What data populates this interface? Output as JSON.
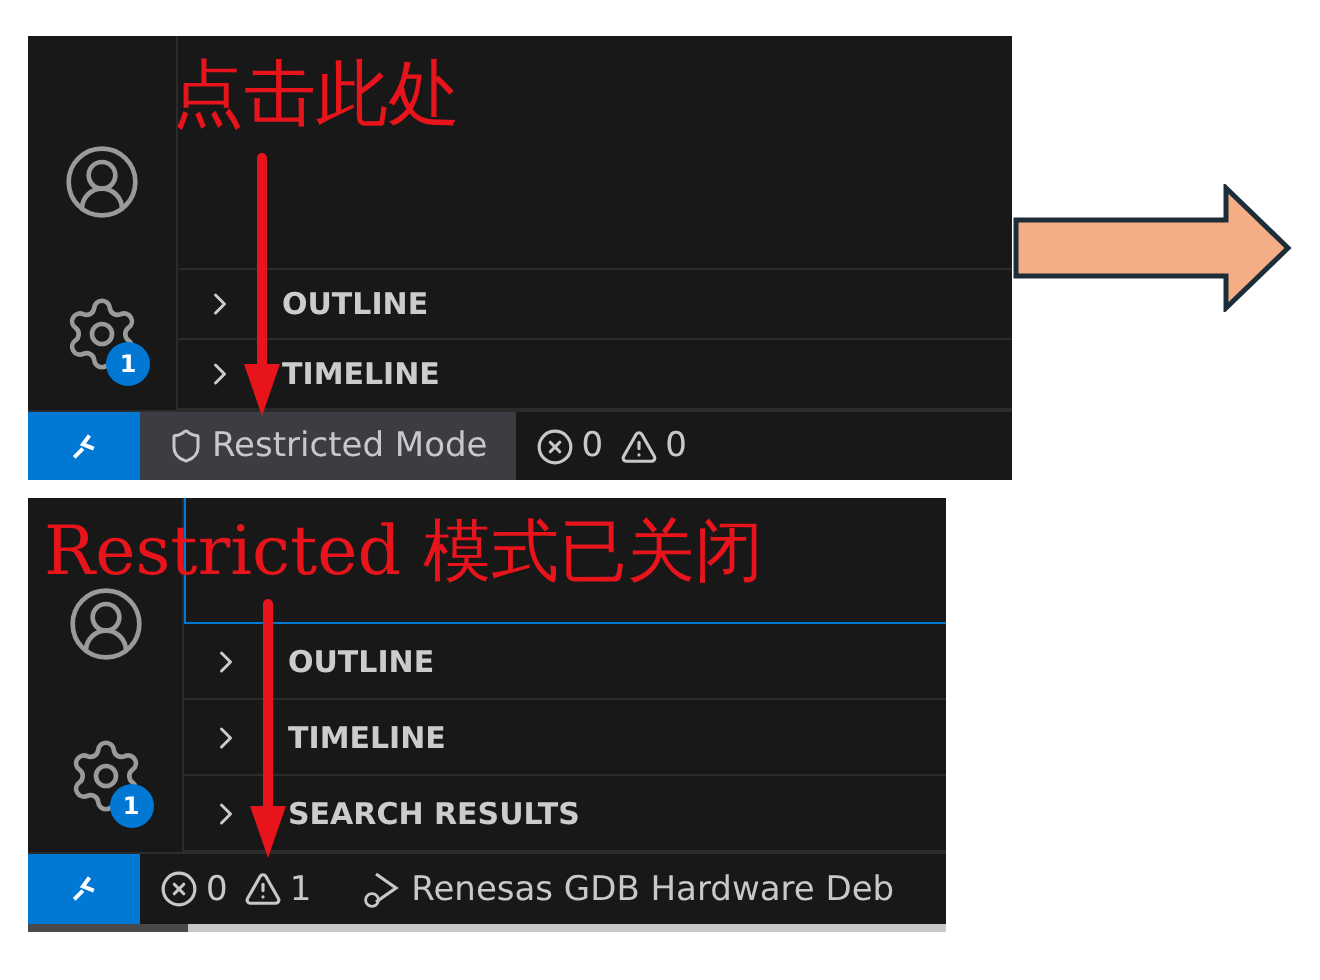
{
  "panels": [
    {
      "annotation": "点击此处",
      "focused_view": false,
      "scrollbar": false,
      "activity_badge": "1",
      "sections": [
        {
          "title": "OUTLINE",
          "expanded": false
        },
        {
          "title": "TIMELINE",
          "expanded": false
        }
      ],
      "status_items": [
        {
          "kind": "remote"
        },
        {
          "kind": "restricted",
          "label": "Restricted Mode"
        },
        {
          "kind": "problems",
          "errors": "0",
          "warnings": "0"
        }
      ]
    },
    {
      "annotation": "Restricted 模式已关闭",
      "focused_view": true,
      "scrollbar": true,
      "activity_badge": "1",
      "sections": [
        {
          "title": "OUTLINE",
          "expanded": false
        },
        {
          "title": "TIMELINE",
          "expanded": false
        },
        {
          "title": "SEARCH RESULTS",
          "expanded": false
        }
      ],
      "status_items": [
        {
          "kind": "remote"
        },
        {
          "kind": "problems",
          "errors": "0",
          "warnings": "1"
        },
        {
          "kind": "debug",
          "label": "Renesas GDB Hardware Deb"
        }
      ]
    }
  ]
}
